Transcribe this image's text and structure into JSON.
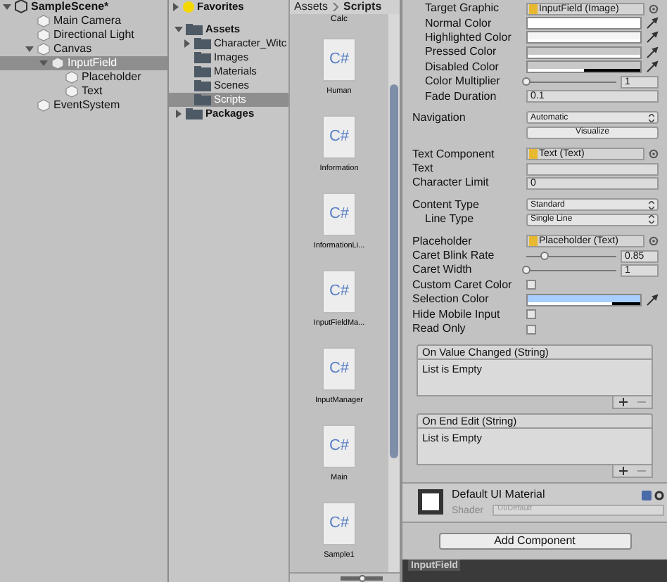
{
  "hierarchy": {
    "scene": "SampleScene*",
    "items": [
      {
        "name": "Main Camera",
        "selected": false
      },
      {
        "name": "Directional Light",
        "selected": false
      },
      {
        "name": "Canvas",
        "selected": false,
        "expanded": true,
        "children": [
          {
            "name": "InputField",
            "selected": true,
            "expanded": true,
            "children": [
              {
                "name": "Placeholder",
                "selected": false
              },
              {
                "name": "Text",
                "selected": false
              }
            ]
          }
        ]
      },
      {
        "name": "EventSystem",
        "selected": false
      }
    ]
  },
  "project": {
    "favorites": "Favorites",
    "tree": [
      {
        "name": "Assets",
        "expanded": true,
        "selected": false,
        "children": [
          {
            "name": "Character_Witc",
            "selected": false,
            "expanded": false
          },
          {
            "name": "Images",
            "selected": false
          },
          {
            "name": "Materials",
            "selected": false
          },
          {
            "name": "Scenes",
            "selected": false
          },
          {
            "name": "Scripts",
            "selected": true
          }
        ]
      },
      {
        "name": "Packages",
        "expanded": false,
        "selected": false
      }
    ],
    "breadcrumb": [
      "Assets",
      "Scripts"
    ],
    "partial_file": "Calc",
    "files": [
      {
        "name": "Human",
        "icon_label": "C#"
      },
      {
        "name": "Information",
        "icon_label": "C#"
      },
      {
        "name": "InformationLi...",
        "icon_label": "C#"
      },
      {
        "name": "InputFieldMa...",
        "icon_label": "C#"
      },
      {
        "name": "InputManager",
        "icon_label": "C#"
      },
      {
        "name": "Main",
        "icon_label": "C#"
      },
      {
        "name": "Sample1",
        "icon_label": "C#"
      }
    ],
    "zoom_slider": {
      "level": 0.5
    }
  },
  "inspector": {
    "rows": [
      {
        "kind": "objectref",
        "label": "Target Graphic",
        "value": "InputField (Image)",
        "indented": true
      },
      {
        "kind": "color",
        "label": "Normal Color",
        "color": "#ffffff",
        "level": 1,
        "indented": true
      },
      {
        "kind": "color",
        "label": "Highlighted Color",
        "color": "#f5f5f5",
        "level": 1,
        "indented": true
      },
      {
        "kind": "color",
        "label": "Pressed Color",
        "color": "#c8c8c8",
        "level": 1,
        "indented": true
      },
      {
        "kind": "color",
        "label": "Disabled Color",
        "color": "#c8c8c8",
        "level": 0.5,
        "indented": true
      },
      {
        "kind": "slider",
        "label": "Color Multiplier",
        "level": 0,
        "reading": "1",
        "indented": true
      },
      {
        "kind": "field",
        "label": "Fade Duration",
        "value": "0.1",
        "indented": true
      },
      {
        "kind": "dropdown",
        "label": "Navigation",
        "value": "Automatic",
        "indented": false
      },
      {
        "kind": "button",
        "label": "Visualize"
      },
      {
        "kind": "objectref",
        "label": "Text Component",
        "value": "Text (Text)",
        "indented": false
      },
      {
        "kind": "field",
        "label": "Text",
        "value": "",
        "indented": false
      },
      {
        "kind": "field",
        "label": "Character Limit",
        "value": "0",
        "indented": false
      },
      {
        "kind": "dropdown",
        "label": "Content Type",
        "value": "Standard",
        "indented": false
      },
      {
        "kind": "dropdown",
        "label": "Line Type",
        "value": "Single Line",
        "indented": true
      },
      {
        "kind": "objectref",
        "label": "Placeholder",
        "value": "Placeholder (Text)",
        "indented": false
      },
      {
        "kind": "slider",
        "label": "Caret Blink Rate",
        "level": 0.2,
        "reading": "0.85",
        "indented": false
      },
      {
        "kind": "slider",
        "label": "Caret Width",
        "level": 0,
        "reading": "1",
        "indented": false
      },
      {
        "kind": "checkbox",
        "label": "Custom Caret Color",
        "checked": false,
        "indented": false
      },
      {
        "kind": "color",
        "label": "Selection Color",
        "color": "#a8cefe",
        "level": 0.75,
        "indented": false
      },
      {
        "kind": "checkbox",
        "label": "Hide Mobile Input",
        "checked": false,
        "indented": false
      },
      {
        "kind": "checkbox",
        "label": "Read Only",
        "checked": false,
        "indented": false
      }
    ],
    "events": [
      {
        "title": "On Value Changed (String)",
        "empty_text": "List is Empty"
      },
      {
        "title": "On End Edit (String)",
        "empty_text": "List is Empty"
      }
    ],
    "material": {
      "name": "Default UI Material",
      "shader_label": "Shader",
      "shader_value": "UI/Default"
    },
    "add_component": "Add Component"
  },
  "bottom_tab": "InputField"
}
